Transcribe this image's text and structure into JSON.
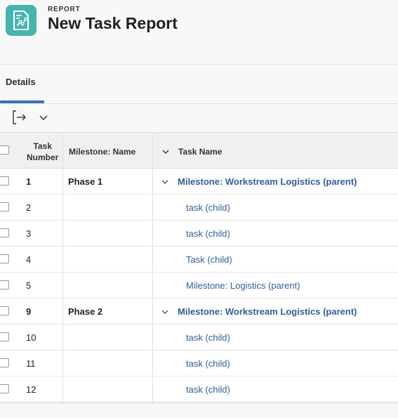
{
  "header": {
    "eyebrow": "REPORT",
    "title": "New Task Report",
    "icon": "report-chart-icon",
    "icon_color": "#45b5b0"
  },
  "tabs": [
    {
      "label": "Details",
      "active": true
    }
  ],
  "toolbar": {
    "export_icon": "export-icon",
    "dropdown_icon": "chevron-down-icon"
  },
  "table": {
    "columns": {
      "task_number": "Task\nNumber",
      "milestone_name": "Milestone: Name",
      "task_name": "Task Name"
    },
    "rows": [
      {
        "task_number": "1",
        "milestone": "Phase 1",
        "task_name": "Milestone: Workstream Logistics (parent)",
        "is_group": true
      },
      {
        "task_number": "2",
        "milestone": "",
        "task_name": "task (child)",
        "is_group": false
      },
      {
        "task_number": "3",
        "milestone": "",
        "task_name": "task (child)",
        "is_group": false
      },
      {
        "task_number": "4",
        "milestone": "",
        "task_name": "Task (child)",
        "is_group": false
      },
      {
        "task_number": "5",
        "milestone": "",
        "task_name": "Milestone: Logistics (parent)",
        "is_group": false
      },
      {
        "task_number": "9",
        "milestone": "Phase 2",
        "task_name": "Milestone: Workstream Logistics (parent)",
        "is_group": true
      },
      {
        "task_number": "10",
        "milestone": "",
        "task_name": "task (child)",
        "is_group": false
      },
      {
        "task_number": "11",
        "milestone": "",
        "task_name": "task (child)",
        "is_group": false
      },
      {
        "task_number": "12",
        "milestone": "",
        "task_name": "task (child)",
        "is_group": false
      }
    ]
  },
  "colors": {
    "link": "#2e5f9e",
    "tab_accent": "#3a6fc4"
  }
}
